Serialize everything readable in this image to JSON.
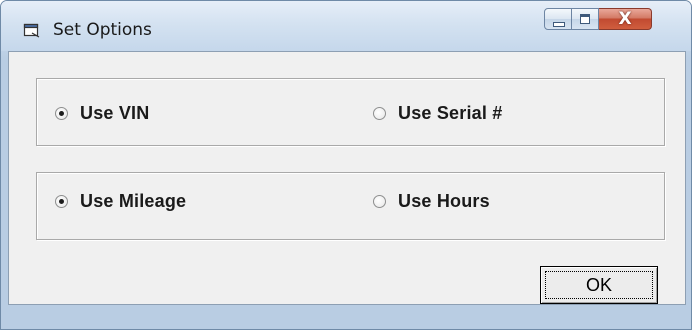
{
  "window": {
    "title": "Set Options",
    "icon": "dialog-window-icon",
    "controls": {
      "minimize_icon": "minimize-icon",
      "maximize_icon": "maximize-icon",
      "close_label": "X"
    }
  },
  "groups": [
    {
      "options": [
        {
          "label": "Use VIN",
          "checked": true
        },
        {
          "label": "Use Serial #",
          "checked": false
        }
      ]
    },
    {
      "options": [
        {
          "label": "Use Mileage",
          "checked": true
        },
        {
          "label": "Use Hours",
          "checked": false
        }
      ]
    }
  ],
  "buttons": {
    "ok_label": "OK"
  }
}
